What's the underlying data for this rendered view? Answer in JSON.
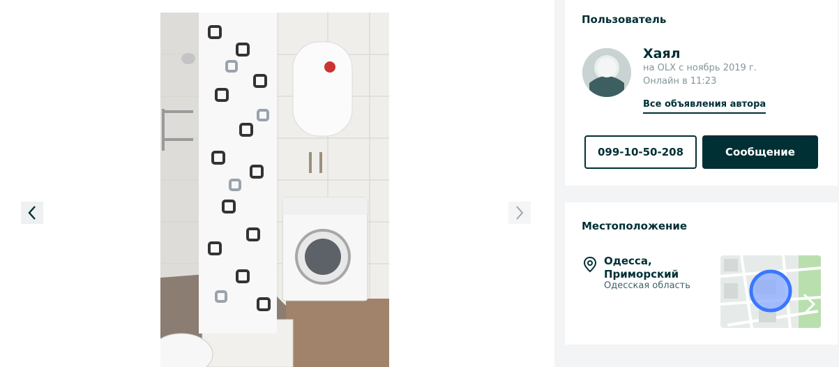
{
  "gallery": {
    "photo_alt": "bathroom-photo",
    "prev_icon": "chevron-left-icon",
    "next_icon": "chevron-right-icon"
  },
  "user": {
    "section_title": "Пользователь",
    "name": "Хаял",
    "member_since": "на OLX с ноябрь 2019 г.",
    "last_online": "Онлайн в 11:23",
    "all_ads_link": "Все объявления автора",
    "phone_button": "099-10-50-208",
    "message_button": "Сообщение"
  },
  "location": {
    "section_title": "Местоположение",
    "city_line1": "Одесса,",
    "city_line2": "Приморский",
    "region": "Одесская область"
  },
  "colors": {
    "brand": "#002f34",
    "map_circle": "#3a77ff"
  }
}
